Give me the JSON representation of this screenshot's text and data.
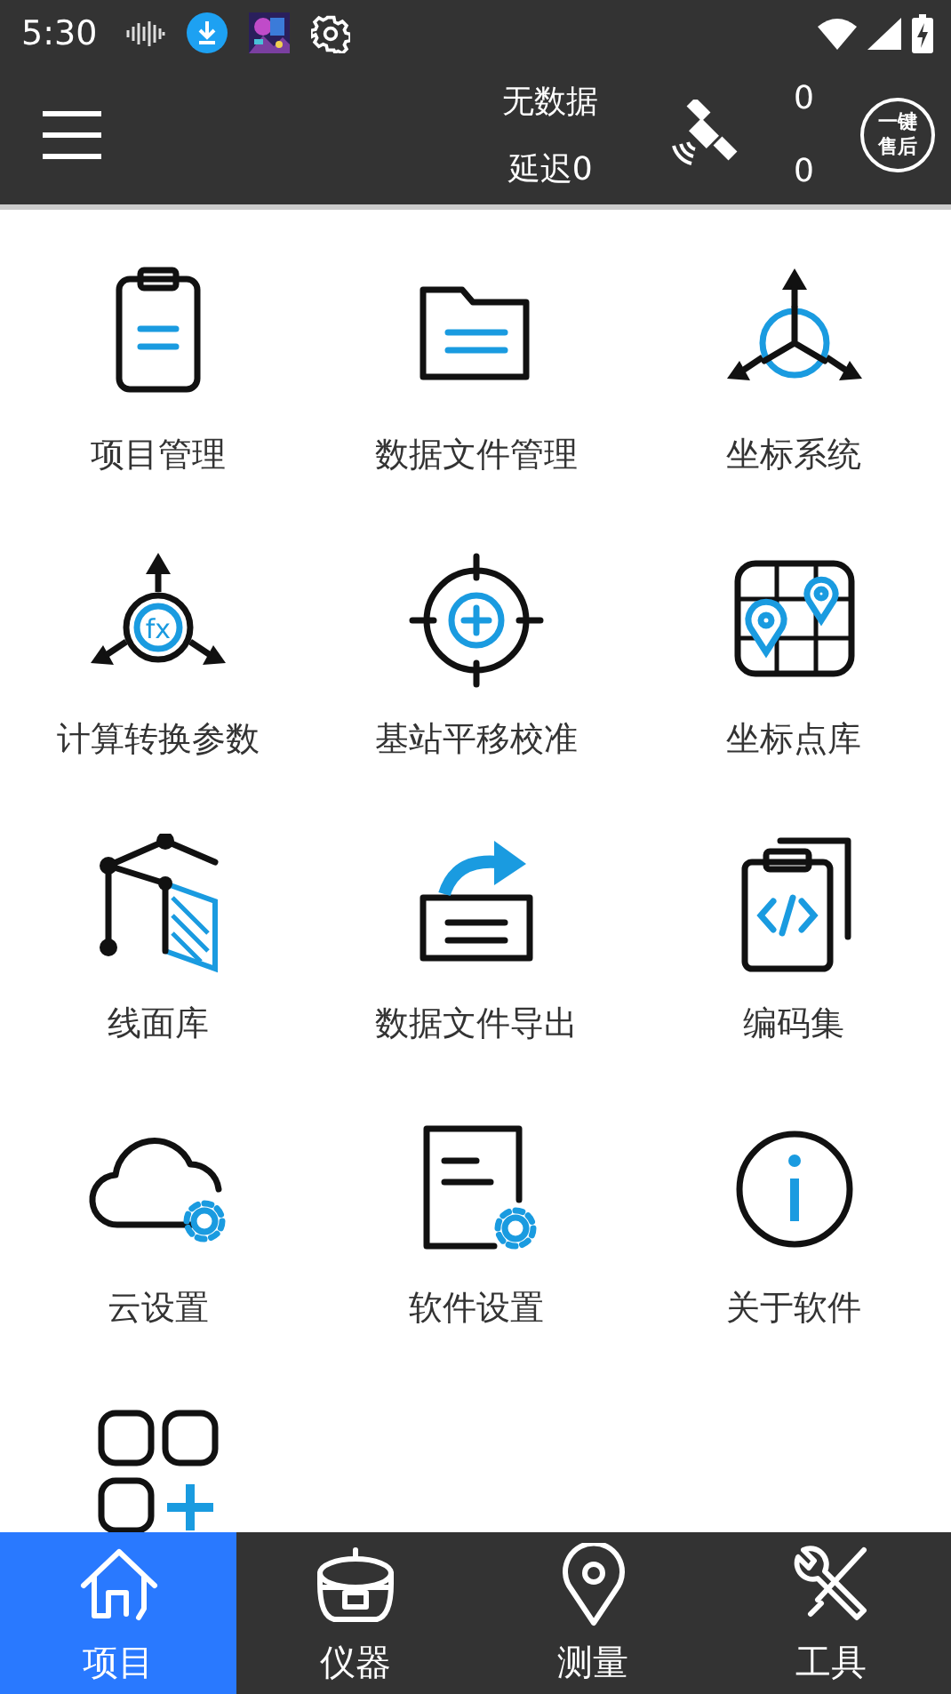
{
  "status_bar": {
    "time": "5:30"
  },
  "header": {
    "status": "无数据",
    "latency": "延迟0",
    "counts": [
      "0",
      "0"
    ],
    "service_button": [
      "一键",
      "售后"
    ]
  },
  "grid": [
    {
      "label": "项目管理"
    },
    {
      "label": "数据文件管理"
    },
    {
      "label": "坐标系统"
    },
    {
      "label": "计算转换参数",
      "icon_text": "fx"
    },
    {
      "label": "基站平移校准"
    },
    {
      "label": "坐标点库"
    },
    {
      "label": "线面库"
    },
    {
      "label": "数据文件导出"
    },
    {
      "label": "编码集"
    },
    {
      "label": "云设置"
    },
    {
      "label": "软件设置"
    },
    {
      "label": "关于软件"
    }
  ],
  "add_button": true,
  "bottom_nav": [
    {
      "label": "项目",
      "selected": true
    },
    {
      "label": "仪器",
      "selected": false
    },
    {
      "label": "测量",
      "selected": false
    },
    {
      "label": "工具",
      "selected": false
    }
  ]
}
